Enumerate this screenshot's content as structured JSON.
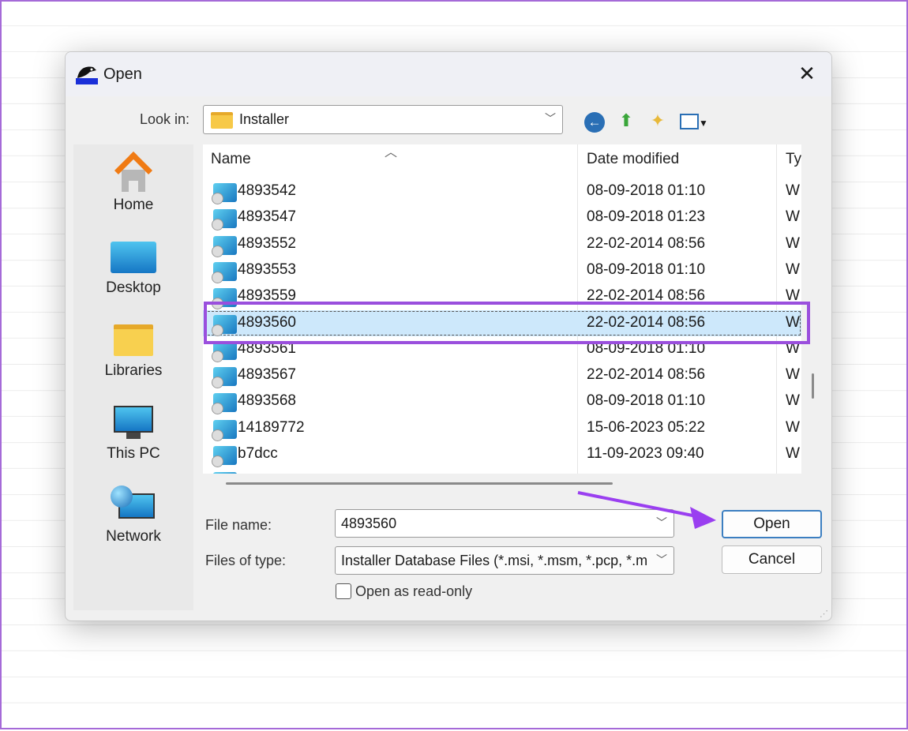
{
  "dialog": {
    "title": "Open",
    "close_icon": "close-icon"
  },
  "look_in": {
    "label": "Look in:",
    "value": "Installer"
  },
  "toolbar": {
    "icons": [
      "back-icon",
      "up-folder-icon",
      "new-folder-icon",
      "view-menu-icon"
    ]
  },
  "places": [
    {
      "label": "Home",
      "icon": "home-icon"
    },
    {
      "label": "Desktop",
      "icon": "desktop-icon"
    },
    {
      "label": "Libraries",
      "icon": "libraries-icon"
    },
    {
      "label": "This PC",
      "icon": "this-pc-icon"
    },
    {
      "label": "Network",
      "icon": "network-icon"
    }
  ],
  "columns": {
    "name": "Name",
    "date": "Date modified",
    "type": "Ty"
  },
  "files": [
    {
      "name": "4893542",
      "date": "08-09-2018 01:10",
      "type": "W"
    },
    {
      "name": "4893547",
      "date": "08-09-2018 01:23",
      "type": "W"
    },
    {
      "name": "4893552",
      "date": "22-02-2014 08:56",
      "type": "W"
    },
    {
      "name": "4893553",
      "date": "08-09-2018 01:10",
      "type": "W"
    },
    {
      "name": "4893559",
      "date": "22-02-2014 08:56",
      "type": "W"
    },
    {
      "name": "4893560",
      "date": "22-02-2014 08:56",
      "type": "W",
      "selected": true
    },
    {
      "name": "4893561",
      "date": "08-09-2018 01:10",
      "type": "W"
    },
    {
      "name": "4893567",
      "date": "22-02-2014 08:56",
      "type": "W"
    },
    {
      "name": "4893568",
      "date": "08-09-2018 01:10",
      "type": "W"
    },
    {
      "name": "14189772",
      "date": "15-06-2023 05:22",
      "type": "W"
    },
    {
      "name": "b7dcc",
      "date": "11-09-2023 09:40",
      "type": "W"
    }
  ],
  "file_name": {
    "label": "File name:",
    "value": "4893560"
  },
  "file_type": {
    "label": "Files of type:",
    "value": "Installer Database Files (*.msi, *.msm, *.pcp, *.m"
  },
  "read_only": {
    "label": "Open as read-only",
    "checked": false
  },
  "buttons": {
    "open": "Open",
    "cancel": "Cancel"
  },
  "colors": {
    "highlight": "#9a4fdd",
    "selection": "#cde8fb"
  }
}
